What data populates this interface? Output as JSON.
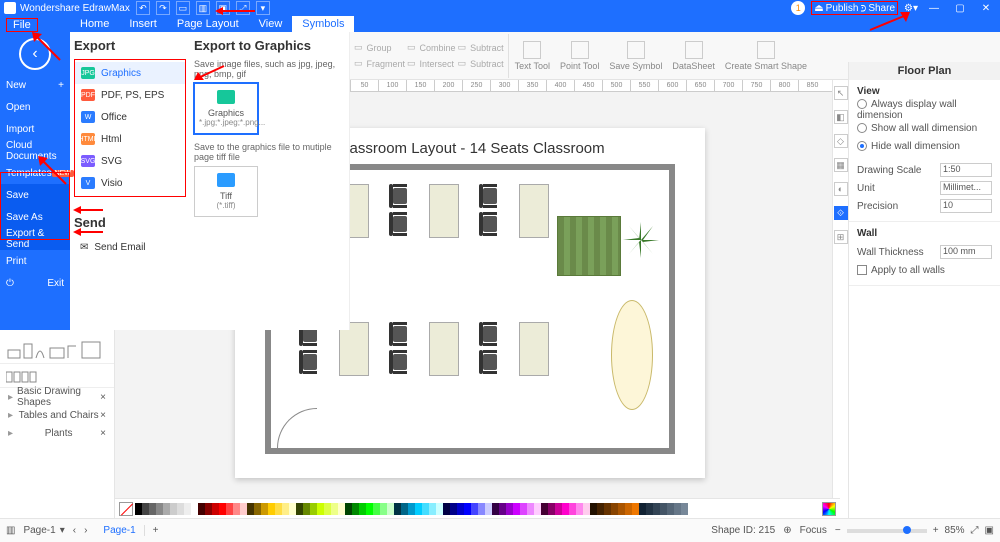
{
  "app": {
    "title": "Wondershare EdrawMax"
  },
  "titlebar": {
    "publish": "Publish",
    "share": "Share"
  },
  "tabs": {
    "file": "File",
    "home": "Home",
    "insert": "Insert",
    "pageLayout": "Page Layout",
    "view": "View",
    "symbols": "Symbols"
  },
  "filemenu": {
    "new": "New",
    "open": "Open",
    "import": "Import",
    "cloud": "Cloud Documents",
    "templates": "Templates",
    "templates_badge": "NEW",
    "save": "Save",
    "saveAs": "Save As",
    "exportSend": "Export & Send",
    "print": "Print",
    "exit": "Exit"
  },
  "export": {
    "heading": "Export",
    "graphics": "Graphics",
    "pdf": "PDF, PS, EPS",
    "office": "Office",
    "html": "Html",
    "svg": "SVG",
    "visio": "Visio",
    "sendHeading": "Send",
    "sendEmail": "Send Email"
  },
  "exportTo": {
    "heading": "Export to Graphics",
    "desc1": "Save image files, such as jpg, jpeg, png, bmp, gif",
    "thumbGraphics": "Graphics",
    "thumbGraphicsSub": "*.jpg;*.jpeg;*.png...",
    "desc2": "Save to the graphics file to mutiple page tiff file",
    "thumbTiff": "Tiff",
    "thumbTiffSub": "(*.tiff)"
  },
  "ribbon": {
    "group": "Group",
    "combine": "Combine",
    "subtract": "Subtract",
    "fragment": "Fragment",
    "intersect": "Intersect",
    "subtract2": "Subtract",
    "textTool": "Text Tool",
    "pointTool": "Point Tool",
    "saveSymbol": "Save Symbol",
    "dataSheet": "DataSheet",
    "createSmart": "Create Smart Shape"
  },
  "ruler": [
    "50",
    "100",
    "150",
    "200",
    "250",
    "300",
    "350",
    "400",
    "450",
    "500",
    "550",
    "600",
    "650",
    "700",
    "750",
    "800",
    "850"
  ],
  "canvas": {
    "title": "Classroom Layout - 14 Seats Classroom"
  },
  "shapes": {
    "cat1": "Basic Drawing Shapes",
    "cat2": "Tables and Chairs",
    "cat3": "Plants"
  },
  "rightpanel": {
    "title": "Floor Plan",
    "view": "View",
    "opt1": "Always display wall dimension",
    "opt2": "Show all wall dimension",
    "opt3": "Hide wall dimension",
    "drawingScale": "Drawing Scale",
    "drawingScaleVal": "1:50",
    "unit": "Unit",
    "unitVal": "Millimet...",
    "precision": "Precision",
    "precisionVal": "10",
    "wall": "Wall",
    "wallThickness": "Wall Thickness",
    "wallThicknessVal": "100 mm",
    "applyAll": "Apply to all walls"
  },
  "status": {
    "page": "Page-1",
    "pageTab": "Page-1",
    "shapeId": "Shape ID: 215",
    "focus": "Focus",
    "zoom": "85%"
  },
  "colors": [
    "#000",
    "#444",
    "#666",
    "#888",
    "#aaa",
    "#ccc",
    "#ddd",
    "#eee",
    "#fff",
    "#400",
    "#800",
    "#c00",
    "#f00",
    "#f44",
    "#f88",
    "#fcc",
    "#430",
    "#860",
    "#c90",
    "#fc0",
    "#fd4",
    "#fe8",
    "#ffc",
    "#340",
    "#680",
    "#9c0",
    "#cf0",
    "#df4",
    "#ef8",
    "#ffc",
    "#040",
    "#080",
    "#0c0",
    "#0f0",
    "#4f4",
    "#8f8",
    "#cfc",
    "#034",
    "#068",
    "#09c",
    "#0cf",
    "#4df",
    "#8ef",
    "#cff",
    "#004",
    "#008",
    "#00c",
    "#00f",
    "#44f",
    "#88f",
    "#ccf",
    "#304",
    "#608",
    "#90c",
    "#c0f",
    "#d4f",
    "#e8f",
    "#fcf",
    "#403",
    "#806",
    "#c09",
    "#f0c",
    "#f4d",
    "#f8e",
    "#fce",
    "#210",
    "#420",
    "#630",
    "#840",
    "#a50",
    "#c60",
    "#e70",
    "#123",
    "#234",
    "#345",
    "#456",
    "#567",
    "#678",
    "#789"
  ]
}
